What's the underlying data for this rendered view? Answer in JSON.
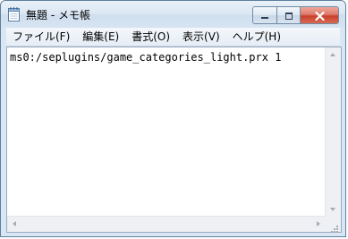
{
  "window": {
    "title": "無題 - メモ帳",
    "icon": "notepad-icon"
  },
  "caption_buttons": {
    "minimize_icon": "minimize-icon",
    "maximize_icon": "maximize-icon",
    "close_icon": "close-icon"
  },
  "menu": {
    "items": [
      {
        "label": "ファイル(F)"
      },
      {
        "label": "編集(E)"
      },
      {
        "label": "書式(O)"
      },
      {
        "label": "表示(V)"
      },
      {
        "label": "ヘルプ(H)"
      }
    ]
  },
  "editor": {
    "content": "ms0:/seplugins/game_categories_light.prx 1"
  },
  "colors": {
    "frame": "#d9e6f3",
    "close_button": "#c9402b",
    "text_background": "#ffffff"
  }
}
